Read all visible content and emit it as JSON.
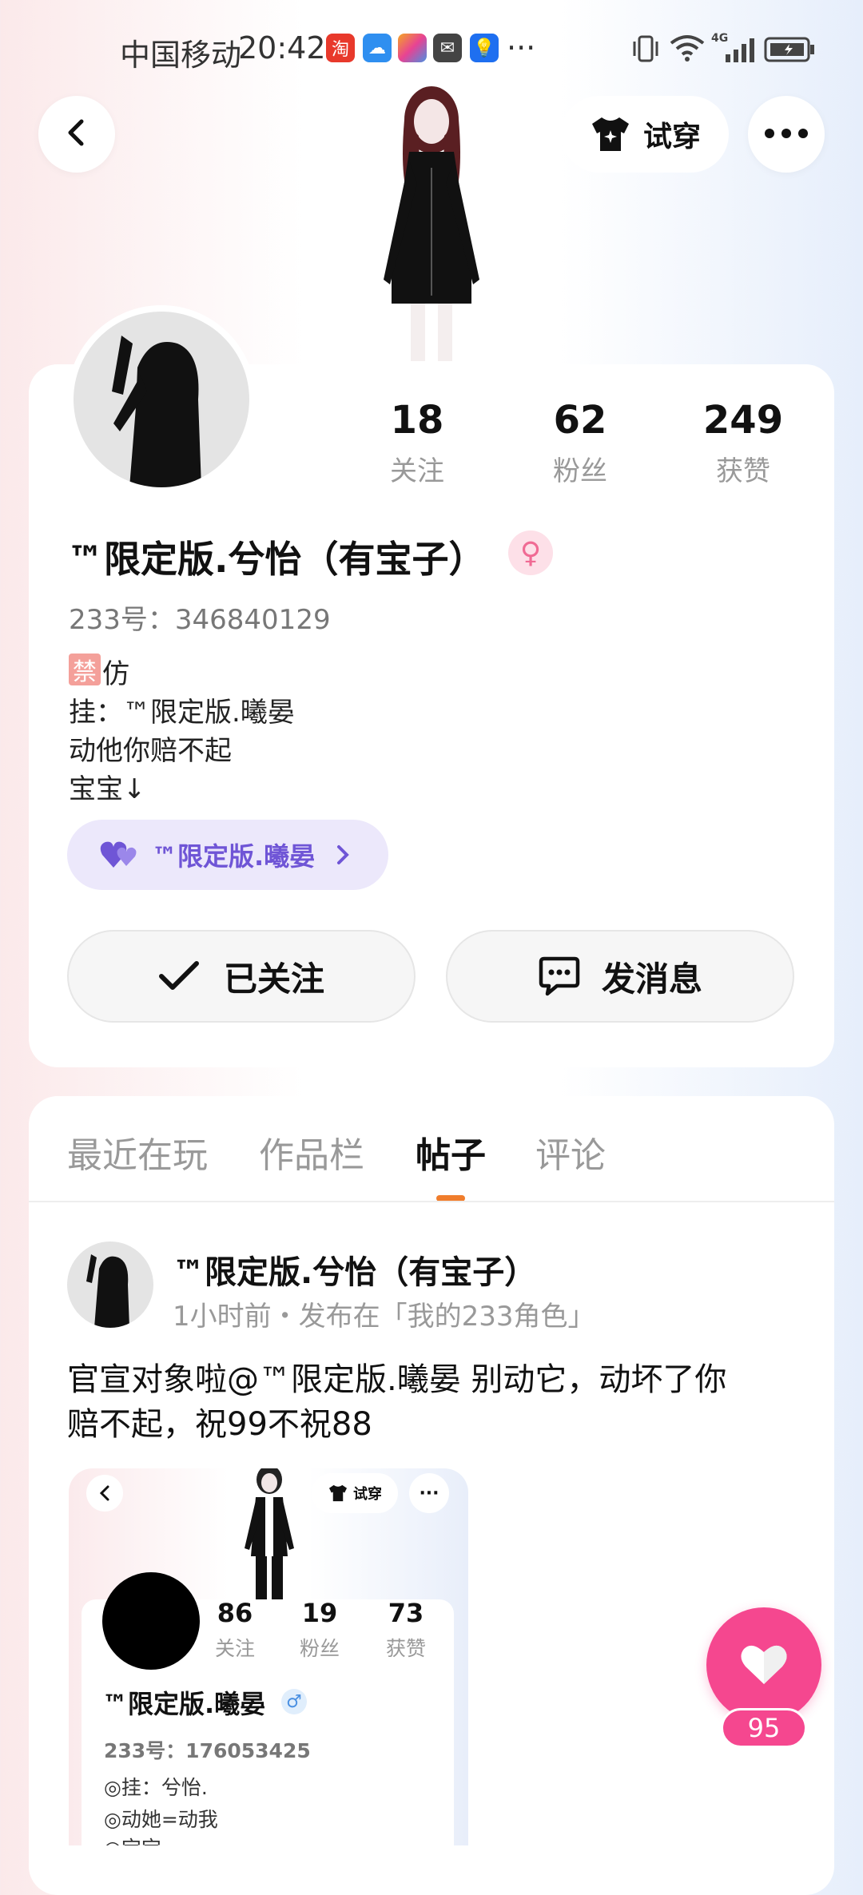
{
  "status_bar": {
    "carrier": "中国移动",
    "time": "20:42",
    "more": "···",
    "network": "4G"
  },
  "header": {
    "tryon_label": "试穿"
  },
  "profile": {
    "stats": [
      {
        "value": "18",
        "label": "关注"
      },
      {
        "value": "62",
        "label": "粉丝"
      },
      {
        "value": "249",
        "label": "获赞"
      }
    ],
    "name": "™限定版.兮怡（有宝子）",
    "gender": "♀",
    "id_text": "233号：346840129",
    "bio_badge": "禁",
    "bio_lines": [
      "仿",
      "挂：™限定版.曦晏",
      "动他你赔不起",
      "宝宝↓"
    ],
    "partner_chip": "™限定版.曦晏",
    "follow_label": "已关注",
    "message_label": "发消息",
    "accent": "#f07d2c"
  },
  "tabs": [
    {
      "label": "最近在玩",
      "active": false
    },
    {
      "label": "作品栏",
      "active": false
    },
    {
      "label": "帖子",
      "active": true
    },
    {
      "label": "评论",
      "active": false
    }
  ],
  "post": {
    "author": "™限定版.兮怡（有宝子）",
    "meta": "1小时前・发布在「我的233角色」",
    "text_line1": "官宣对象啦@™限定版.曦晏  别动它，动坏了你",
    "text_line2": "赔不起，祝99不祝88",
    "embed": {
      "tryon_label": "试穿",
      "more": "···",
      "stats": [
        {
          "value": "86",
          "label": "关注"
        },
        {
          "value": "19",
          "label": "粉丝"
        },
        {
          "value": "73",
          "label": "获赞"
        }
      ],
      "name": "™限定版.曦晏",
      "gender": "♂",
      "id_text": "233号：176053425",
      "bio_lines": [
        "◎挂：兮怡.",
        "◎动她=动我",
        "◎宝宝"
      ]
    }
  },
  "like": {
    "count": "95",
    "color": "#f5478f"
  }
}
